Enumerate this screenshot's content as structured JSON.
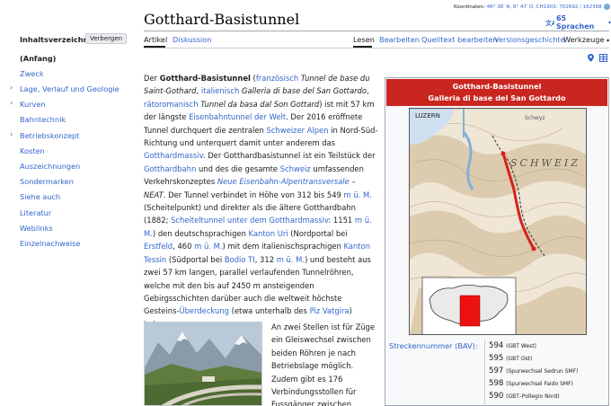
{
  "coords": {
    "prefix": "Koordinaten: ",
    "value": "46° 36′ N, 8° 47′ O; CH1903: 702692 / 162368"
  },
  "page": {
    "title": "Gotthard-Basistunnel",
    "languages": "65 Sprachen"
  },
  "tabs": {
    "article": "Artikel",
    "discussion": "Diskussion",
    "read": "Lesen",
    "edit": "Bearbeiten",
    "edit_source": "Quelltext bearbeiten",
    "history": "Versionsgeschichte",
    "tools": "Werkzeuge"
  },
  "toc": {
    "title": "Inhaltsverzeichnis",
    "hide": "Verbergen",
    "items": [
      {
        "label": "(Anfang)"
      },
      {
        "label": "Zweck"
      },
      {
        "label": "Lage, Verlauf und Geologie"
      },
      {
        "label": "Kurven"
      },
      {
        "label": "Bahntechnik"
      },
      {
        "label": "Betriebskonzept"
      },
      {
        "label": "Kosten"
      },
      {
        "label": "Auszeichnungen"
      },
      {
        "label": "Sondermarken"
      },
      {
        "label": "Siehe auch"
      },
      {
        "label": "Literatur"
      },
      {
        "label": "Weblinks"
      },
      {
        "label": "Einzelnachweise"
      }
    ]
  },
  "article": {
    "p1": [
      {
        "t": "Der "
      },
      {
        "t": "Gotthard-Basistunnel",
        "b": true
      },
      {
        "t": " ("
      },
      {
        "t": "französisch",
        "a": true
      },
      {
        "t": " "
      },
      {
        "t": "Tunnel de base du Saint-Gothard",
        "i": true
      },
      {
        "t": ", "
      },
      {
        "t": "italienisch",
        "a": true
      },
      {
        "t": " "
      },
      {
        "t": "Galleria di base del San Gottardo",
        "i": true
      },
      {
        "t": ", "
      },
      {
        "t": "rätoromanisch",
        "a": true
      },
      {
        "t": " "
      },
      {
        "t": "Tunnel da basa dal Son Gottard",
        "i": true
      },
      {
        "t": ") ist mit 57 km der längste "
      },
      {
        "t": "Eisenbahntunnel der Welt",
        "a": true
      },
      {
        "t": ". Der 2016 eröffnete Tunnel durchquert die zentralen "
      },
      {
        "t": "Schweizer Alpen",
        "a": true
      },
      {
        "t": " in Nord-Süd-Richtung und unterquert damit unter anderem das "
      },
      {
        "t": "Gotthardmassiv",
        "a": true
      },
      {
        "t": ". Der Gotthardbasistunnel ist ein Teilstück der "
      },
      {
        "t": "Gotthardbahn",
        "a": true
      },
      {
        "t": " und des die gesamte "
      },
      {
        "t": "Schweiz",
        "a": true
      },
      {
        "t": " umfassenden Verkehrskonzeptes "
      },
      {
        "t": "Neue Eisenbahn-Alpentransversale",
        "a": true,
        "i": true
      },
      {
        "t": " – "
      },
      {
        "t": "NEAT",
        "i": true
      },
      {
        "t": ". Der Tunnel verbindet in Höhe von 312 bis 549 "
      },
      {
        "t": "m ü. M.",
        "a": true
      },
      {
        "t": " (Scheitelpunkt) und direkter als die ältere Gotthardbahn (1882; "
      },
      {
        "t": "Scheiteltunnel unter dem Gotthardmassiv",
        "a": true
      },
      {
        "t": ": 1151 "
      },
      {
        "t": "m ü. M.",
        "a": true
      },
      {
        "t": ") den deutschsprachigen "
      },
      {
        "t": "Kanton Uri",
        "a": true
      },
      {
        "t": " (Nordportal bei "
      },
      {
        "t": "Erstfeld",
        "a": true
      },
      {
        "t": ", 460 "
      },
      {
        "t": "m ü. M.",
        "a": true
      },
      {
        "t": ") mit dem italienischsprachigen "
      },
      {
        "t": "Kanton Tessin",
        "a": true
      },
      {
        "t": " (Südportal bei "
      },
      {
        "t": "Bodio TI",
        "a": true
      },
      {
        "t": ", 312 "
      },
      {
        "t": "m ü. M.",
        "a": true
      },
      {
        "t": ") und besteht aus zwei 57 km langen, parallel verlaufenden Tunnelröhren, welche mit den bis auf 2450 m ansteigenden Gebirgsschichten darüber auch die weltweit höchste Gesteins-"
      },
      {
        "t": "Überdeckung",
        "a": true
      },
      {
        "t": " (etwa unterhalb des "
      },
      {
        "t": "Piz Vatgira",
        "a": true
      },
      {
        "t": ") haben."
      }
    ],
    "p2": "An zwei Stellen ist für Züge ein Gleiswechsel zwischen beiden Röhren je nach Betriebslage möglich. Zudem gibt es 176 Verbindungsstollen für Fussgänger zwischen beiden"
  },
  "infobox": {
    "title_line1": "Gotthard-Basistunnel",
    "title_line2": "Galleria di base del San Gottardo",
    "map_labels": {
      "luzern": "LUZERN",
      "schweiz": "SCHWEIZ",
      "schwyz": "Schwyz"
    },
    "row_label": "Streckennummer (BAV):",
    "numbers": [
      {
        "num": "594",
        "note": "(GBT West)"
      },
      {
        "num": "595",
        "note": "(GBT Ost)"
      },
      {
        "num": "597",
        "note": "(Spurwechsel Sedrun SMF)"
      },
      {
        "num": "598",
        "note": "(Spurwechsel Faido SMF)"
      },
      {
        "num": "590",
        "note": "(GBT–Pollegio Nord)"
      }
    ],
    "accent": "#c9261f"
  },
  "colors": {
    "link": "#3366cc",
    "text": "#202122"
  }
}
